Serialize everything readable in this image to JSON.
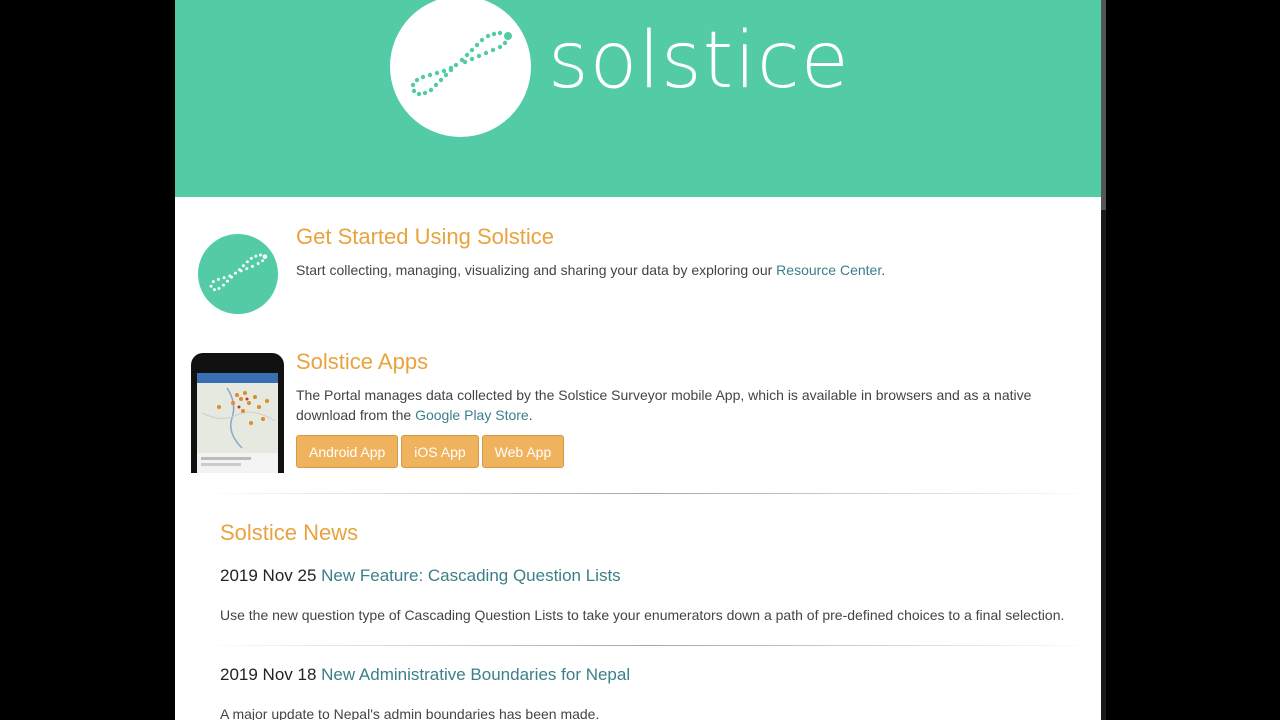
{
  "brand": {
    "name": "solstice"
  },
  "get_started": {
    "heading": "Get Started Using Solstice",
    "text": "Start collecting, managing, visualizing and sharing your data by exploring our ",
    "link": "Resource Center",
    "suffix": "."
  },
  "apps": {
    "heading": "Solstice Apps",
    "text": "The Portal manages data collected by the Solstice Surveyor mobile App, which is available in browsers and as a native download from the ",
    "link": "Google Play Store",
    "suffix": ".",
    "buttons": [
      "Android App",
      "iOS App",
      "Web App"
    ]
  },
  "news": {
    "heading": "Solstice News",
    "items": [
      {
        "date": "2019 Nov 25",
        "title": "New Feature: Cascading Question Lists",
        "body": "Use the new question type of Cascading Question Lists to take your enumerators down a path of pre-defined choices to a final selection."
      },
      {
        "date": "2019 Nov 18",
        "title": "New Administrative Boundaries for Nepal",
        "body": "A major update to Nepal's admin boundaries has been made."
      }
    ]
  },
  "colors": {
    "teal": "#52cba6",
    "orange": "#e9a33e",
    "link": "#3b7f8a",
    "button": "#efb25d"
  }
}
